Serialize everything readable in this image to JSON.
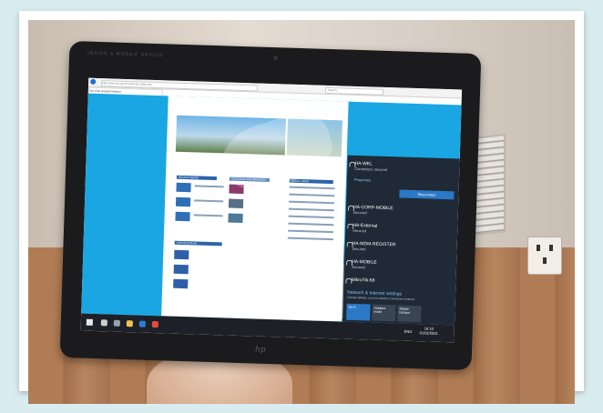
{
  "tablet": {
    "brand_top": "INSIDE A MOBILE DEVICE",
    "logo": "hp"
  },
  "browser": {
    "url": "http://www.ha.org.hk/visitor/ha_index.asp",
    "search_placeholder": "Search...",
    "tab_label": "Yan Chai Hospital Intranet"
  },
  "page": {
    "sections": [
      "RECENT NEWS",
      "FEATURED INFORMATION",
      "QUICK LINKS",
      "APPRECIATION"
    ]
  },
  "wifi": {
    "current": {
      "name": "HA-WKL",
      "status": "Connected, secured"
    },
    "properties_label": "Properties",
    "disconnect_label": "Disconnect",
    "networks": [
      {
        "name": "HA-CORP-MOBILE",
        "status": "Secured"
      },
      {
        "name": "HA-External",
        "status": "Secured"
      },
      {
        "name": "HA-MDM-REGISTER",
        "status": "Secured"
      },
      {
        "name": "HA-MOBILE",
        "status": "Secured"
      },
      {
        "name": "MikroTik-68",
        "status": ""
      }
    ],
    "settings_label": "Network & Internet settings",
    "settings_sub": "Change settings, such as making a connection metered.",
    "quick_actions": [
      "Wi-Fi",
      "Airplane mode",
      "Mobile hotspot"
    ]
  },
  "taskbar": {
    "language": "ENG",
    "time": "16:10",
    "date": "01/02/2021"
  }
}
